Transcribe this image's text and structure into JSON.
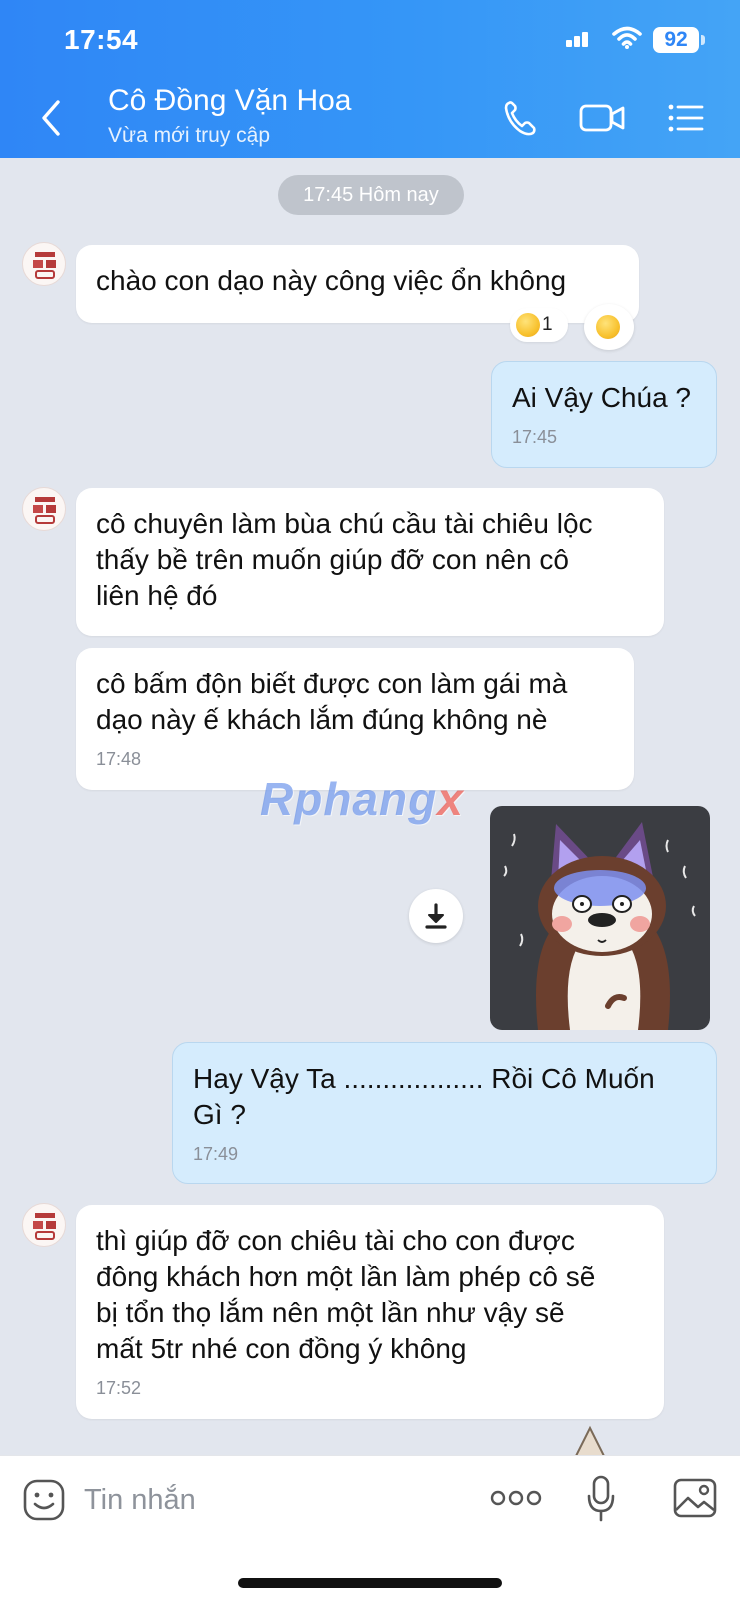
{
  "status_bar": {
    "time": "17:54",
    "battery": "92"
  },
  "header": {
    "contact_name": "Cô Đồng Vặn Hoa",
    "contact_status": "Vừa mới truy cập"
  },
  "chat": {
    "date_chip": "17:45 Hôm nay",
    "messages": [
      {
        "direction": "in",
        "text": "chào con dạo này công việc ổn không",
        "time": ""
      },
      {
        "direction": "out",
        "text": "Ai Vậy Chúa ?",
        "time": "17:45"
      },
      {
        "direction": "in",
        "text": "cô chuyên làm bùa chú cầu tài chiêu lộc\nthấy bề trên muốn giúp đỡ con nên cô\nliên hệ đó",
        "time": ""
      },
      {
        "direction": "in",
        "text": "cô bấm độn biết được con làm gái mà\ndạo này ế khách lắm đúng không nè",
        "time": "17:48"
      },
      {
        "direction": "out",
        "text": "Hay Vậy Ta .................. Rồi Cô Muốn\nGì ?",
        "time": "17:49"
      },
      {
        "direction": "in",
        "text": "thì giúp đỡ con chiêu tài cho con được\nđông khách hơn một lần làm phép cô sẽ\nbị tổn thọ lắm nên một lần như vậy sẽ\nmất 5tr nhé con đồng ý không",
        "time": "17:52"
      }
    ],
    "reaction_count": "1",
    "watermark": {
      "main": "Rphang",
      "accent": "x"
    }
  },
  "composer": {
    "placeholder": "Tin nhắn"
  },
  "icons": {
    "back": "back-chevron-icon",
    "call": "phone-icon",
    "video": "video-camera-icon",
    "menu": "list-menu-icon",
    "sticker": "smiley-sticker-icon",
    "more": "more-dots-icon",
    "mic": "microphone-icon",
    "image": "image-gallery-icon",
    "download": "download-icon"
  },
  "colors": {
    "header_gradient_start": "#2f86f6",
    "header_gradient_end": "#44a4f6",
    "incoming_bubble": "#ffffff",
    "outgoing_bubble": "#d5ecfd",
    "chat_background": "#e2e6ee"
  }
}
